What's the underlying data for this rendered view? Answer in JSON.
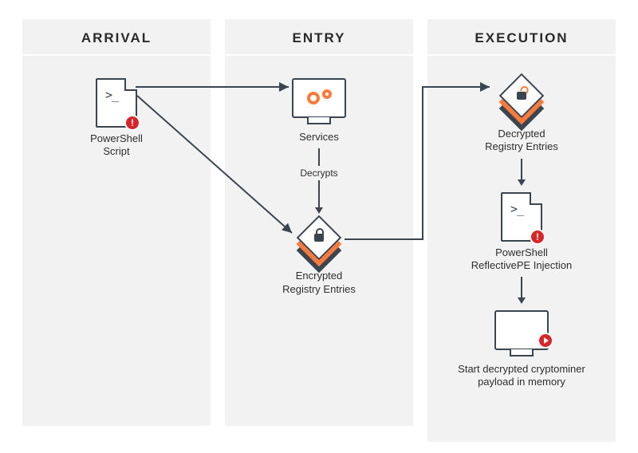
{
  "columns": {
    "arrival": {
      "title": "ARRIVAL"
    },
    "entry": {
      "title": "ENTRY"
    },
    "execution": {
      "title": "EXECUTION"
    }
  },
  "nodes": {
    "ps_script": {
      "line1": "PowerShell",
      "line2": "Script"
    },
    "services": {
      "line1": "Services"
    },
    "encrypted_registry": {
      "line1": "Encrypted",
      "line2": "Registry Entries"
    },
    "decrypted_registry": {
      "line1": "Decrypted",
      "line2": "Registry Entries"
    },
    "ps_reflective": {
      "line1": "PowerShell",
      "line2": "ReflectivePE Injection"
    },
    "start_payload": {
      "line1": "Start decrypted cryptominer",
      "line2": "payload in memory"
    }
  },
  "edges": {
    "decrypts": "Decrypts"
  }
}
